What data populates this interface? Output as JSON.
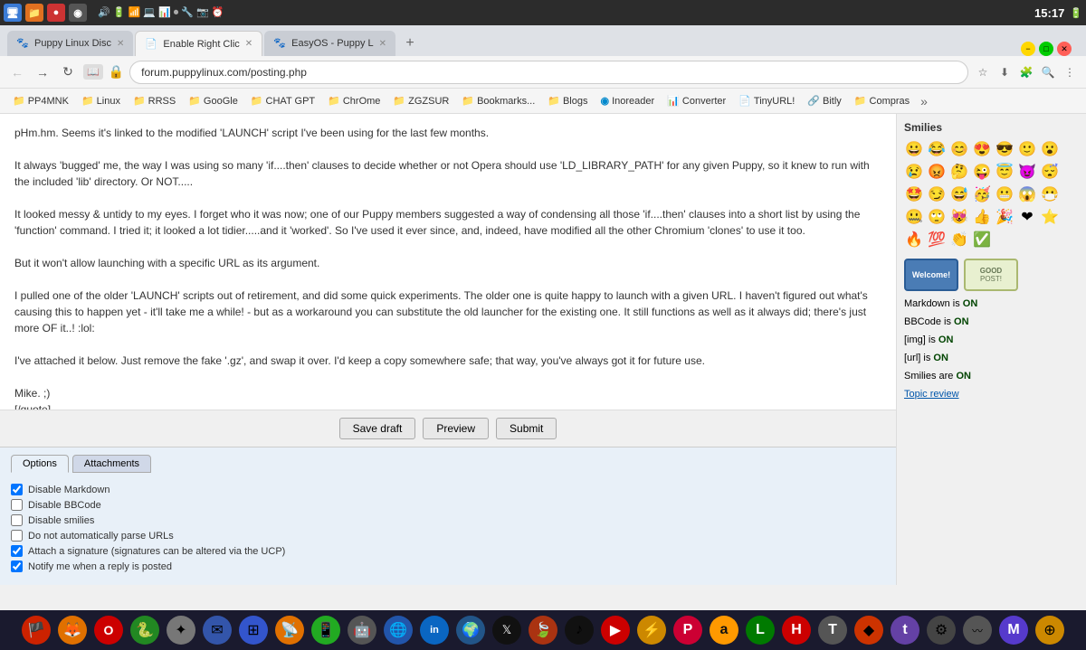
{
  "topbar": {
    "clock": "15:17",
    "icons": [
      "🖥",
      "📁",
      "🌐",
      "⚙",
      "📊"
    ]
  },
  "browser": {
    "tabs": [
      {
        "id": "tab1",
        "label": "Puppy Linux Disc",
        "active": false,
        "favicon": "🐾"
      },
      {
        "id": "tab2",
        "label": "Enable Right Clic",
        "active": true,
        "favicon": "📄"
      },
      {
        "id": "tab3",
        "label": "EasyOS - Puppy L",
        "active": false,
        "favicon": "🐾"
      }
    ],
    "address": "forum.puppylinux.com/posting.php",
    "secure": true
  },
  "bookmarks": [
    {
      "id": "bm1",
      "label": "PP4MNK"
    },
    {
      "id": "bm2",
      "label": "Linux"
    },
    {
      "id": "bm3",
      "label": "RRSS"
    },
    {
      "id": "bm4",
      "label": "GooGle"
    },
    {
      "id": "bm5",
      "label": "CHAT GPT"
    },
    {
      "id": "bm6",
      "label": "ChrOme"
    },
    {
      "id": "bm7",
      "label": "ZGZSUR"
    },
    {
      "id": "bm8",
      "label": "Bookmarks..."
    },
    {
      "id": "bm9",
      "label": "Blogs"
    },
    {
      "id": "bm10",
      "label": "Inoreader"
    },
    {
      "id": "bm11",
      "label": "Converter"
    },
    {
      "id": "bm12",
      "label": "TinyURL!"
    },
    {
      "id": "bm13",
      "label": "Bitly"
    },
    {
      "id": "bm14",
      "label": "Compras"
    }
  ],
  "editor": {
    "content": "pHm.hm. Seems it's linked to the modified 'LAUNCH' script I've been using for the last few months.\n\nIt always 'bugged' me, the way I was using so many 'if....then' clauses to decide whether or not Opera should use 'LD_LIBRARY_PATH' for any given Puppy, so it knew to run with the included 'lib' directory. Or NOT.....\n\nIt looked messy & untidy to my eyes. I forget who it was now; one of our Puppy members suggested a way of condensing all those 'if....then' clauses into a short list by using the 'function' command. I tried it; it looked a lot tidier.....and it 'worked'. So I've used it ever since, and, indeed, have modified all the other Chromium 'clones' to use it too.\n\nBut it won't allow launching with a specific URL as its argument.\n\nI pulled one of the older 'LAUNCH' scripts out of retirement, and did some quick experiments. The older one is quite happy to launch with a given URL. I haven't figured out what's causing this to happen yet - it'll take me a while! - but as a workaround you can substitute the old launcher for the existing one. It still functions as well as it always did; there's just more OF it..! :lol:\n\nI've attached it below. Just remove the fake '.gz', and swap it over. I'd keep a copy somewhere safe; that way, you've always got it for future use.\n\nMike. ;)\n[/quote]\n\n\nWith this LAUNCH modification/update Opera ROCKS again and it works as hell.\n\nFantastic, thanks a lot (I suggest to update the file with this modified launch, if possible)"
  },
  "actions": {
    "save_draft": "Save draft",
    "preview": "Preview",
    "submit": "Submit"
  },
  "options": {
    "tab_options": "Options",
    "tab_attachments": "Attachments",
    "checkboxes": [
      {
        "id": "disable_markdown",
        "label": "Disable Markdown",
        "checked": true
      },
      {
        "id": "disable_bbcode",
        "label": "Disable BBCode",
        "checked": false
      },
      {
        "id": "disable_smilies",
        "label": "Disable smilies",
        "checked": false
      },
      {
        "id": "no_auto_parse_urls",
        "label": "Do not automatically parse URLs",
        "checked": false
      },
      {
        "id": "attach_signature",
        "label": "Attach a signature (signatures can be altered via the UCP)",
        "checked": true
      },
      {
        "id": "notify_reply",
        "label": "Notify me when a reply is posted",
        "checked": true
      }
    ]
  },
  "smilies_panel": {
    "title": "Smilies",
    "smilies": [
      "😀",
      "😂",
      "😊",
      "😍",
      "😎",
      "🙂",
      "😮",
      "😢",
      "😡",
      "🤔",
      "😜",
      "😇",
      "😈",
      "😴",
      "🤩",
      "😏",
      "😅",
      "🥳",
      "😬",
      "😱",
      "😷",
      "🤐",
      "🙄",
      "😻",
      "👍",
      "🎉",
      "❤",
      "⭐",
      "🔥",
      "💯",
      "👏",
      "✅"
    ],
    "welcome_badge": "Welcome!",
    "good_post_badge": "GOOD POST!",
    "markdown_status": "Markdown is ON",
    "bbcode_status": "BBCode is ON",
    "img_status": "[img] is ON",
    "url_status": "[url] is ON",
    "smilies_status": "Smilies are ON",
    "topic_review": "Topic review"
  },
  "taskbar_bottom": {
    "icons": [
      {
        "id": "flag",
        "emoji": "🏴",
        "bg": "#cc2200"
      },
      {
        "id": "firefox",
        "emoji": "🦊",
        "bg": "#e07000"
      },
      {
        "id": "opera",
        "emoji": "O",
        "bg": "#cc0000"
      },
      {
        "id": "snake",
        "emoji": "🐍",
        "bg": "#228822"
      },
      {
        "id": "star",
        "emoji": "✦",
        "bg": "#888"
      },
      {
        "id": "mail",
        "emoji": "✉",
        "bg": "#3355aa"
      },
      {
        "id": "win",
        "emoji": "⊞",
        "bg": "#3355cc"
      },
      {
        "id": "rss",
        "emoji": "📡",
        "bg": "#e07000"
      },
      {
        "id": "phone",
        "emoji": "📱",
        "bg": "#22aa22"
      },
      {
        "id": "ai",
        "emoji": "🤖",
        "bg": "#555"
      },
      {
        "id": "net",
        "emoji": "🌐",
        "bg": "#2255aa"
      },
      {
        "id": "linkedin",
        "emoji": "in",
        "bg": "#0a66c2"
      },
      {
        "id": "globe2",
        "emoji": "🌍",
        "bg": "#225588"
      },
      {
        "id": "x",
        "emoji": "𝕏",
        "bg": "#111"
      },
      {
        "id": "leaf",
        "emoji": "🍃",
        "bg": "#aa3311"
      },
      {
        "id": "tiktok",
        "emoji": "♪",
        "bg": "#111"
      },
      {
        "id": "youtube",
        "emoji": "▶",
        "bg": "#cc0000"
      },
      {
        "id": "bolt",
        "emoji": "⚡",
        "bg": "#cc8800"
      },
      {
        "id": "pinterest",
        "emoji": "P",
        "bg": "#cc0033"
      },
      {
        "id": "amazon",
        "emoji": "a",
        "bg": "#ff9900"
      },
      {
        "id": "leroy",
        "emoji": "L",
        "bg": "#007a00"
      },
      {
        "id": "H",
        "emoji": "H",
        "bg": "#cc0000"
      },
      {
        "id": "T",
        "emoji": "T",
        "bg": "#555"
      },
      {
        "id": "gem",
        "emoji": "◆",
        "bg": "#cc3300"
      },
      {
        "id": "twitch",
        "emoji": "t",
        "bg": "#6441a5"
      },
      {
        "id": "tools",
        "emoji": "⚙",
        "bg": "#444"
      },
      {
        "id": "wave",
        "emoji": "〰",
        "bg": "#555"
      },
      {
        "id": "mastodon",
        "emoji": "M",
        "bg": "#563acc"
      },
      {
        "id": "compass",
        "emoji": "⊕",
        "bg": "#cc8800"
      }
    ]
  }
}
